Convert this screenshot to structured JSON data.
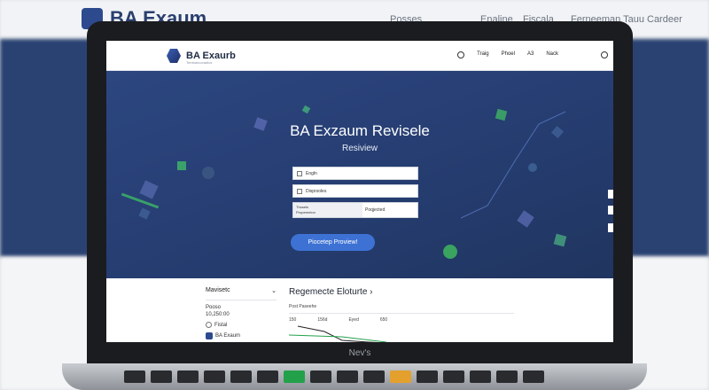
{
  "background": {
    "logo_text": "BA Exaum",
    "nav": [
      "Posses",
      "Enaline",
      "Fiscala",
      "Ferneeman Tauu",
      "Cardeer"
    ]
  },
  "laptop": {
    "bezel_label": "Nev's"
  },
  "site": {
    "logo_name": "BA Exaurb",
    "logo_tagline": "Tembancoradlos",
    "nav": [
      "Traig",
      "Phoel",
      "A3",
      "Nack"
    ],
    "hero": {
      "title": "BA Exzaum Revisele",
      "subtitle": "Resiview",
      "fields": {
        "login": "Engln",
        "dropdown": "Disprsoles",
        "split_left_line1": "Thosels",
        "split_left_line2": "Propereeion",
        "split_right": "Poqjected"
      },
      "cta_label": "Piocetep Proview!"
    },
    "lower": {
      "menu_heading": "Mavisetc",
      "menu_items": [
        {
          "text": "Pooso"
        },
        {
          "text": "10,250:00"
        },
        {
          "text": "Fistal"
        },
        {
          "text": "BA Exaum"
        }
      ],
      "section_heading": "Regemecte Eloturte",
      "section_arrow": "›",
      "meta_text": "Post Paseehe",
      "meta_numbers": [
        "150",
        "156d",
        "Eyed",
        "650"
      ]
    }
  },
  "colors": {
    "hero_bg": "#2a4272",
    "cta": "#3d72d4",
    "accent_green": "#22a14a"
  }
}
